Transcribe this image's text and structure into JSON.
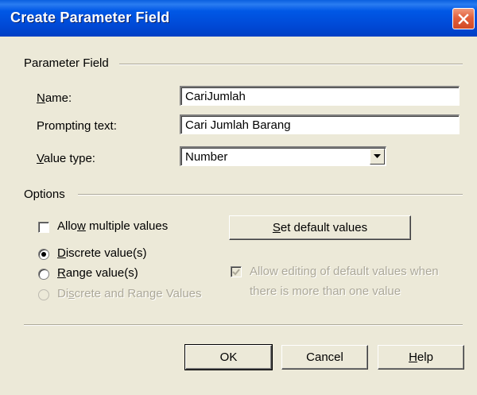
{
  "window": {
    "title": "Create Parameter Field"
  },
  "parameter_field": {
    "group_label": "Parameter Field",
    "name_label": "Name:",
    "name_value": "CariJumlah",
    "prompting_label": "Prompting text:",
    "prompting_value": "Cari Jumlah Barang",
    "value_type_label": "Value type:",
    "value_type_value": "Number"
  },
  "options": {
    "group_label": "Options",
    "allow_multiple": "Allow multiple values",
    "discrete": "Discrete value(s)",
    "range": "Range value(s)",
    "discrete_range": "Discrete and Range Values",
    "set_default": "Set default values",
    "allow_editing_line1": "Allow editing of default values when",
    "allow_editing_line2": "there is more than one value"
  },
  "buttons": {
    "ok": "OK",
    "cancel": "Cancel",
    "help": "Help"
  },
  "colors": {
    "titlebar": "#0054e3",
    "dialog_bg": "#ece9d8",
    "close_button": "#e2603c",
    "disabled_text": "#aca899"
  }
}
